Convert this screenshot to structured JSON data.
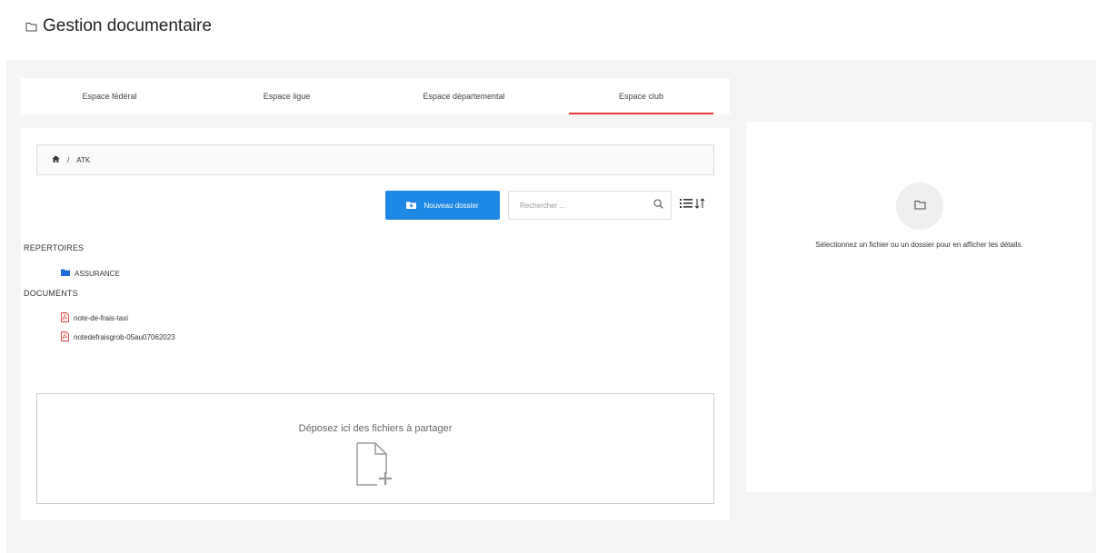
{
  "page": {
    "title": "Gestion documentaire"
  },
  "tabs": [
    {
      "label": "Espace fédéral",
      "active": false
    },
    {
      "label": "Espace ligue",
      "active": false
    },
    {
      "label": "Espace départemental",
      "active": false
    },
    {
      "label": "Espace club",
      "active": true
    }
  ],
  "breadcrumb": {
    "separator": "/",
    "current": "ATK"
  },
  "toolbar": {
    "new_folder_label": "Nouveau dossier",
    "search_placeholder": "Rechercher ...",
    "search_value": ""
  },
  "repertoires": {
    "heading": "REPERTOIRES",
    "items": [
      {
        "name": "ASSURANCE"
      }
    ]
  },
  "documents": {
    "heading": "DOCUMENTS",
    "items": [
      {
        "name": "note-de-frais-taxi"
      },
      {
        "name": "notedefraisgrob-05au07062023"
      }
    ]
  },
  "dropzone": {
    "text": "Déposez ici des fichiers à partager"
  },
  "details": {
    "text": "Sélectionnez un fichier ou un dossier pour en afficher les détails."
  },
  "colors": {
    "accent": "#1e88e5",
    "active_tab": "#e53935",
    "pdf": "#e53935",
    "folder": "#1e6fd9"
  },
  "icons": [
    "folder-outline-icon",
    "home-icon",
    "folder-plus-icon",
    "search-icon",
    "list-view-icon",
    "sort-icon",
    "folder-icon",
    "pdf-icon",
    "file-add-icon"
  ]
}
